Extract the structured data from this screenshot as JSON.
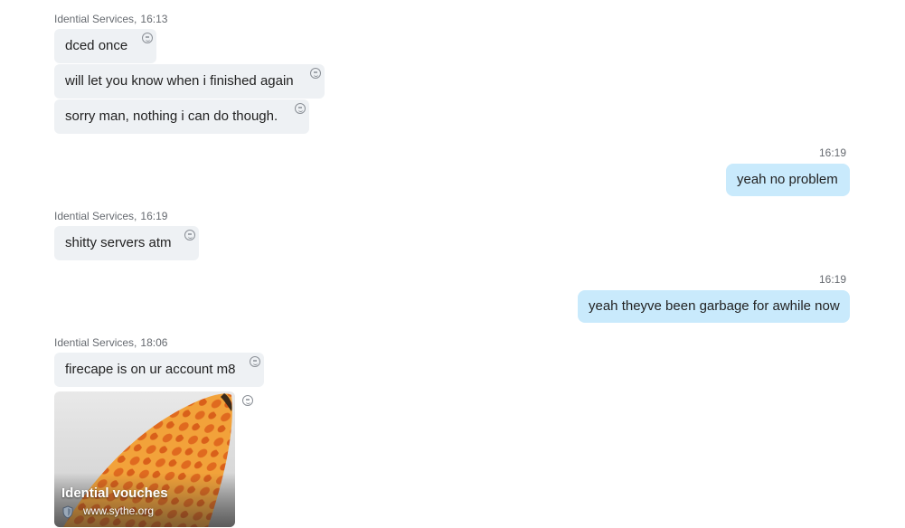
{
  "messages": {
    "g1": {
      "sender": "Idential Services,",
      "time": "16:13"
    },
    "m1": "dced once",
    "m2": "will let you know when i finished again",
    "m3": "sorry man, nothing i can do though.",
    "o1": {
      "time": "16:19",
      "text": "yeah no problem"
    },
    "g2": {
      "sender": "Idential Services,",
      "time": "16:19"
    },
    "m4": "shitty servers atm",
    "o2": {
      "time": "16:19",
      "text": "yeah theyve been garbage for awhile now"
    },
    "g3": {
      "sender": "Idential Services,",
      "time": "18:06"
    },
    "m5": "firecape is on ur account m8",
    "link_card": {
      "title": "Idential vouches",
      "domain": "www.sythe.org",
      "icon": "shield-icon"
    }
  },
  "colors": {
    "incoming_bubble": "#eef1f4",
    "outgoing_bubble": "#c9eafc",
    "meta_text": "#666a70"
  },
  "icons": {
    "reaction": "smiley-reaction-icon"
  }
}
